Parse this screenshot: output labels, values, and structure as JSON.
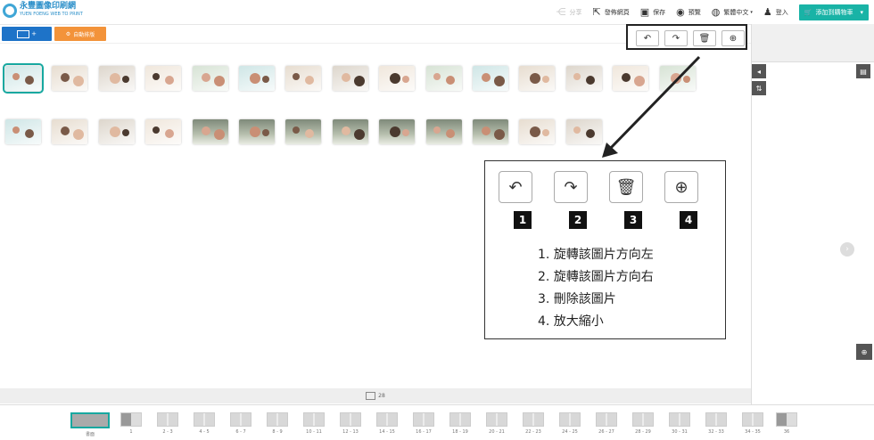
{
  "header": {
    "logo_cn": "永豐圖像印刷網",
    "logo_en": "YUEN FOENG WEB TO PRINT",
    "nav": {
      "share": "分享",
      "publish": "發佈網頁",
      "save": "保存",
      "preview": "預覽",
      "language": "繁體中文",
      "login": "登入",
      "cart": "添加到購物車"
    }
  },
  "toolbar": {
    "add_photo": "+",
    "auto_layout": "自動排版"
  },
  "legend": {
    "numbers": [
      "1",
      "2",
      "3",
      "4"
    ],
    "items": [
      "1. 旋轉該圖片方向左",
      "2. 旋轉該圖片方向右",
      "3. 刪除該圖片",
      "4. 放大縮小"
    ]
  },
  "photo_count": "28",
  "pages": [
    "書面",
    "1",
    "2 - 3",
    "4 - 5",
    "6 - 7",
    "8 - 9",
    "10 - 11",
    "12 - 13",
    "14 - 15",
    "16 - 17",
    "18 - 19",
    "20 - 21",
    "22 - 23",
    "24 - 25",
    "26 - 27",
    "28 - 29",
    "30 - 31",
    "32 - 33",
    "34 - 35",
    "36"
  ],
  "colors": {
    "accent": "#17a8a0",
    "blue": "#1e73c8",
    "orange": "#f3933a"
  },
  "icons": {
    "rotate_left": "rotate-left-icon",
    "rotate_right": "rotate-right-icon",
    "delete": "trash-icon",
    "zoom": "zoom-in-icon"
  }
}
